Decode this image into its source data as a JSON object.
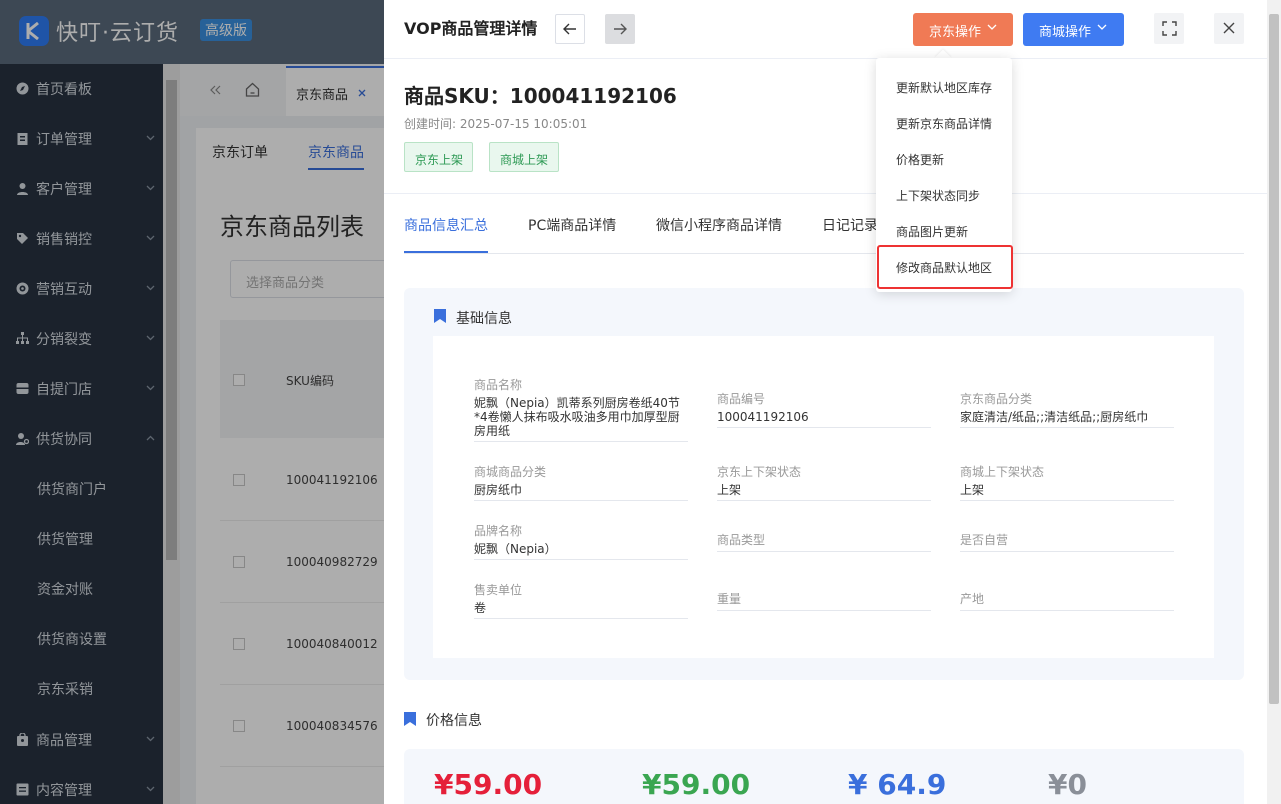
{
  "app": {
    "brand": "快叮·云订货",
    "edition": "高级版"
  },
  "sidebar": {
    "items": [
      {
        "label": "首页看板",
        "icon": "compass-icon"
      },
      {
        "label": "订单管理",
        "icon": "clipboard-icon"
      },
      {
        "label": "客户管理",
        "icon": "user-icon"
      },
      {
        "label": "销售销控",
        "icon": "tag-icon"
      },
      {
        "label": "营销互动",
        "icon": "target-icon"
      },
      {
        "label": "分销裂变",
        "icon": "hierarchy-icon"
      },
      {
        "label": "自提门店",
        "icon": "store-icon"
      },
      {
        "label": "供货协同",
        "icon": "user-gear-icon"
      }
    ],
    "sub_items": [
      "供货商门户",
      "供货管理",
      "资金对账",
      "供货商设置",
      "京东采销"
    ],
    "bottom_items": [
      {
        "label": "商品管理",
        "icon": "bag-icon"
      },
      {
        "label": "内容管理",
        "icon": "content-icon"
      }
    ]
  },
  "tabs": {
    "active": "京东商品"
  },
  "subtabs": {
    "orders": "京东订单",
    "goods": "京东商品"
  },
  "list": {
    "title": "京东商品列表",
    "category_placeholder": "选择商品分类",
    "column_sku": "SKU编码",
    "rows": [
      "100041192106",
      "100040982729",
      "100040840012",
      "100040834576"
    ]
  },
  "drawer": {
    "title": "VOP商品管理详情",
    "jd_ops": "京东操作",
    "mall_ops": "商城操作",
    "sku_title": "商品SKU：100041192106",
    "created": "创建时间: 2025-07-15 10:05:01",
    "tags": [
      "京东上架",
      "商城上架"
    ],
    "tabs": [
      "商品信息汇总",
      "PC端商品详情",
      "微信小程序商品详情",
      "日记记录"
    ],
    "basic": {
      "header": "基础信息",
      "fields": [
        {
          "label": "商品名称",
          "value": "妮飘（Nepia）凯蒂系列厨房卷纸40节*4卷懒人抹布吸水吸油多用巾加厚型厨房用纸"
        },
        {
          "label": "商品编号",
          "value": "100041192106"
        },
        {
          "label": "京东商品分类",
          "value": "家庭清洁/纸品;;清洁纸品;;厨房纸巾"
        },
        {
          "label": "商城商品分类",
          "value": "厨房纸巾"
        },
        {
          "label": "京东上下架状态",
          "value": "上架"
        },
        {
          "label": "商城上下架状态",
          "value": "上架"
        },
        {
          "label": "品牌名称",
          "value": "妮飘（Nepia）"
        },
        {
          "label": "商品类型",
          "value": ""
        },
        {
          "label": "是否自营",
          "value": ""
        },
        {
          "label": "售卖单位",
          "value": "卷"
        },
        {
          "label": "重量",
          "value": ""
        },
        {
          "label": "产地",
          "value": ""
        }
      ]
    },
    "price": {
      "header": "价格信息",
      "values": [
        "¥59.00",
        "¥59.00",
        "¥ 64.9",
        "¥0"
      ],
      "colors": [
        "#e5203a",
        "#3aa651",
        "#3a6fdc",
        "#8a8f98"
      ]
    }
  },
  "dropdown": {
    "items": [
      "更新默认地区库存",
      "更新京东商品详情",
      "价格更新",
      "上下架状态同步",
      "商品图片更新",
      "修改商品默认地区"
    ]
  }
}
